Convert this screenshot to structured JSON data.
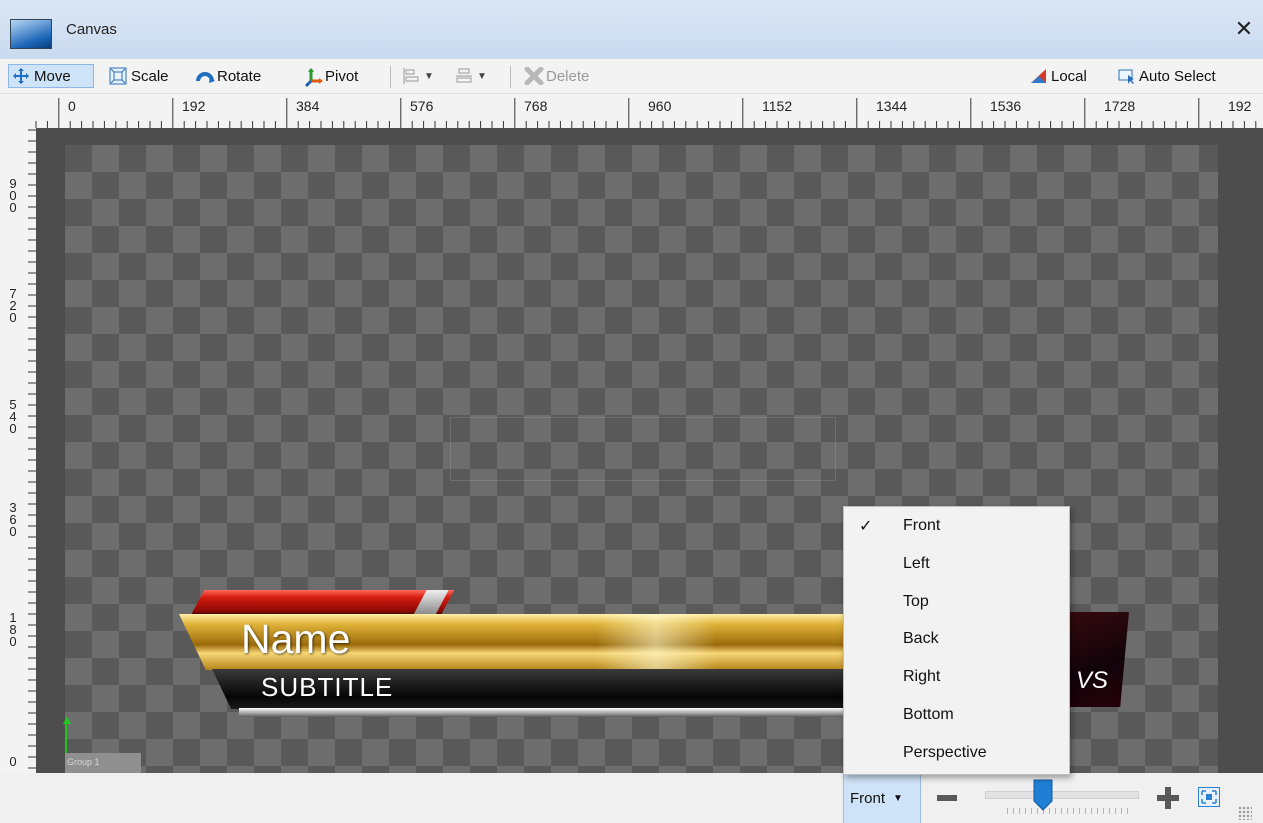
{
  "window": {
    "title": "Canvas",
    "close_glyph": "✕"
  },
  "toolbar": {
    "move_label": "Move",
    "scale_label": "Scale",
    "rotate_label": "Rotate",
    "pivot_label": "Pivot",
    "delete_label": "Delete",
    "local_label": "Local",
    "auto_select_label": "Auto Select",
    "active_tool": "Move"
  },
  "ruler": {
    "horizontal": [
      "0",
      "192",
      "384",
      "576",
      "768",
      "960",
      "1152",
      "1344",
      "1536",
      "1728",
      "192"
    ],
    "vertical": [
      "900",
      "720",
      "540",
      "360",
      "180",
      "0"
    ]
  },
  "canvas": {
    "group_label": "Group 1",
    "lower_third": {
      "name": "Name",
      "subtitle": "SUBTITLE",
      "right_fragment": "VS"
    }
  },
  "view_menu": {
    "current": "Front",
    "items": [
      {
        "label": "Front",
        "checked": true
      },
      {
        "label": "Left",
        "checked": false
      },
      {
        "label": "Top",
        "checked": false
      },
      {
        "label": "Back",
        "checked": false
      },
      {
        "label": "Right",
        "checked": false
      },
      {
        "label": "Bottom",
        "checked": false
      },
      {
        "label": "Perspective",
        "checked": false
      }
    ]
  },
  "colors": {
    "accent": "#1f7fd4",
    "selection_bg": "#cfe3f8",
    "axis_green": "#21c421"
  }
}
